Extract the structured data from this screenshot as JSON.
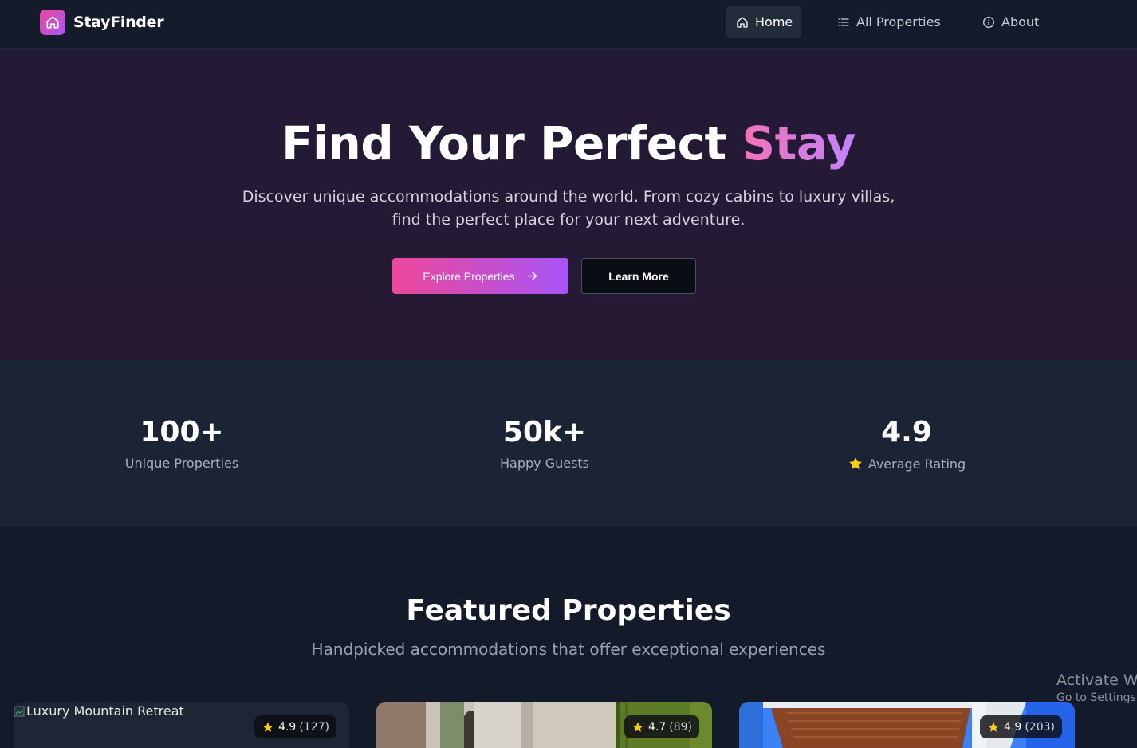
{
  "nav": {
    "brand": "StayFinder",
    "items": [
      {
        "label": "Home",
        "icon": "home-icon",
        "active": true
      },
      {
        "label": "All Properties",
        "icon": "list-icon",
        "active": false
      },
      {
        "label": "About",
        "icon": "info-icon",
        "active": false
      }
    ]
  },
  "hero": {
    "title_main": "Find Your Perfect ",
    "title_accent": "Stay",
    "subtitle_line1": "Discover unique accommodations around the world. From cozy cabins to luxury villas,",
    "subtitle_line2": "find the perfect place for your next adventure.",
    "primary_button": "Explore Properties",
    "secondary_button": "Learn More"
  },
  "stats": [
    {
      "value": "100+",
      "label": "Unique Properties"
    },
    {
      "value": "50k+",
      "label": "Happy Guests"
    },
    {
      "value": "4.9",
      "label": "Average Rating",
      "icon": "star-icon"
    }
  ],
  "featured": {
    "title": "Featured Properties",
    "subtitle": "Handpicked accommodations that offer exceptional experiences",
    "cards": [
      {
        "image_alt": "Luxury Mountain Retreat",
        "rating": "4.9",
        "reviews": "(127)"
      },
      {
        "rating": "4.7",
        "reviews": "(89)"
      },
      {
        "rating": "4.9",
        "reviews": "(203)"
      }
    ]
  },
  "watermark": {
    "line1": "Activate Wi",
    "line2": "Go to Settings t"
  },
  "colors": {
    "accent_pink": "#ec4899",
    "accent_purple": "#a855f7",
    "background": "#131b2b",
    "star": "#facc15"
  }
}
